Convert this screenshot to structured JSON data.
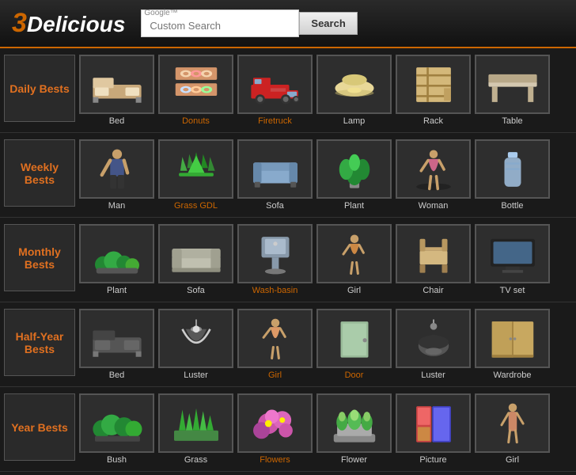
{
  "header": {
    "logo_three": "3",
    "logo_rest": "Delicious",
    "search_placeholder": "Custom Search",
    "search_label": "Search"
  },
  "sections": [
    {
      "id": "daily",
      "label": "Daily\nBests",
      "items": [
        {
          "name": "Bed",
          "color": "white",
          "shape": "bed"
        },
        {
          "name": "Donuts",
          "color": "orange",
          "shape": "donuts"
        },
        {
          "name": "Firetruck",
          "color": "orange",
          "shape": "truck"
        },
        {
          "name": "Lamp",
          "color": "white",
          "shape": "lamp"
        },
        {
          "name": "Rack",
          "color": "white",
          "shape": "rack"
        },
        {
          "name": "Table",
          "color": "white",
          "shape": "table"
        }
      ]
    },
    {
      "id": "weekly",
      "label": "Weekly\nBests",
      "items": [
        {
          "name": "Man",
          "color": "white",
          "shape": "man"
        },
        {
          "name": "Grass GDL",
          "color": "orange",
          "shape": "grass"
        },
        {
          "name": "Sofa",
          "color": "white",
          "shape": "sofa"
        },
        {
          "name": "Plant",
          "color": "white",
          "shape": "plant"
        },
        {
          "name": "Woman",
          "color": "white",
          "shape": "woman"
        },
        {
          "name": "Bottle",
          "color": "white",
          "shape": "bottle"
        }
      ]
    },
    {
      "id": "monthly",
      "label": "Monthly\nBests",
      "items": [
        {
          "name": "Plant",
          "color": "white",
          "shape": "plant2"
        },
        {
          "name": "Sofa",
          "color": "white",
          "shape": "sofa2"
        },
        {
          "name": "Wash-basin",
          "color": "orange",
          "shape": "basin"
        },
        {
          "name": "Girl",
          "color": "white",
          "shape": "girl"
        },
        {
          "name": "Chair",
          "color": "white",
          "shape": "chair"
        },
        {
          "name": "TV set",
          "color": "white",
          "shape": "tv"
        }
      ]
    },
    {
      "id": "halfyear",
      "label": "Half-Year\nBests",
      "items": [
        {
          "name": "Bed",
          "color": "white",
          "shape": "bed2"
        },
        {
          "name": "Luster",
          "color": "white",
          "shape": "luster"
        },
        {
          "name": "Girl",
          "color": "orange",
          "shape": "girl2"
        },
        {
          "name": "Door",
          "color": "orange",
          "shape": "door"
        },
        {
          "name": "Luster",
          "color": "white",
          "shape": "luster2"
        },
        {
          "name": "Wardrobe",
          "color": "white",
          "shape": "wardrobe"
        }
      ]
    },
    {
      "id": "year",
      "label": "Year\nBests",
      "items": [
        {
          "name": "Bush",
          "color": "white",
          "shape": "bush"
        },
        {
          "name": "Grass",
          "color": "white",
          "shape": "grass2"
        },
        {
          "name": "Flowers",
          "color": "orange",
          "shape": "flowers"
        },
        {
          "name": "Flower",
          "color": "white",
          "shape": "flower"
        },
        {
          "name": "Picture",
          "color": "white",
          "shape": "picture"
        },
        {
          "name": "Girl",
          "color": "white",
          "shape": "girl3"
        }
      ]
    }
  ]
}
